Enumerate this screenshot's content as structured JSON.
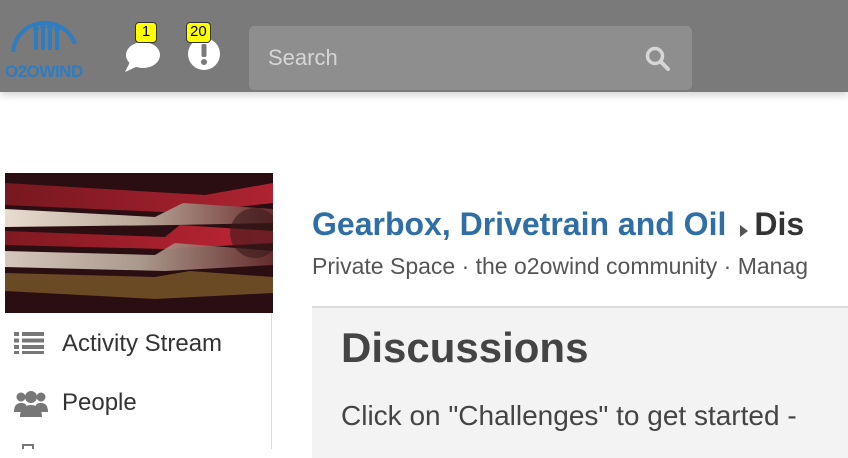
{
  "header": {
    "logo_text": "O2OWIND",
    "messages_badge": "1",
    "notifications_badge": "20",
    "search_placeholder": "Search",
    "icons": {
      "logo": "o2owind-logo-icon",
      "messages": "chat-bubble-icon",
      "notifications": "exclamation-circle-icon",
      "search": "search-icon"
    }
  },
  "sidebar": {
    "image_description_icon": "gearbox-image",
    "items": [
      {
        "label": "Activity Stream",
        "icon": "list-icon"
      },
      {
        "label": "People",
        "icon": "people-icon"
      }
    ]
  },
  "main": {
    "breadcrumb": {
      "link": "Gearbox, Drivetrain and Oil",
      "current": "Dis"
    },
    "meta": "Private Space · the o2owind community · Manag",
    "content": {
      "title": "Discussions",
      "text": "Click on \"Challenges\" to get started -"
    }
  },
  "colors": {
    "topbar": "#7a7a7a",
    "link": "#2f6fa6",
    "badge": "#ffff00"
  }
}
